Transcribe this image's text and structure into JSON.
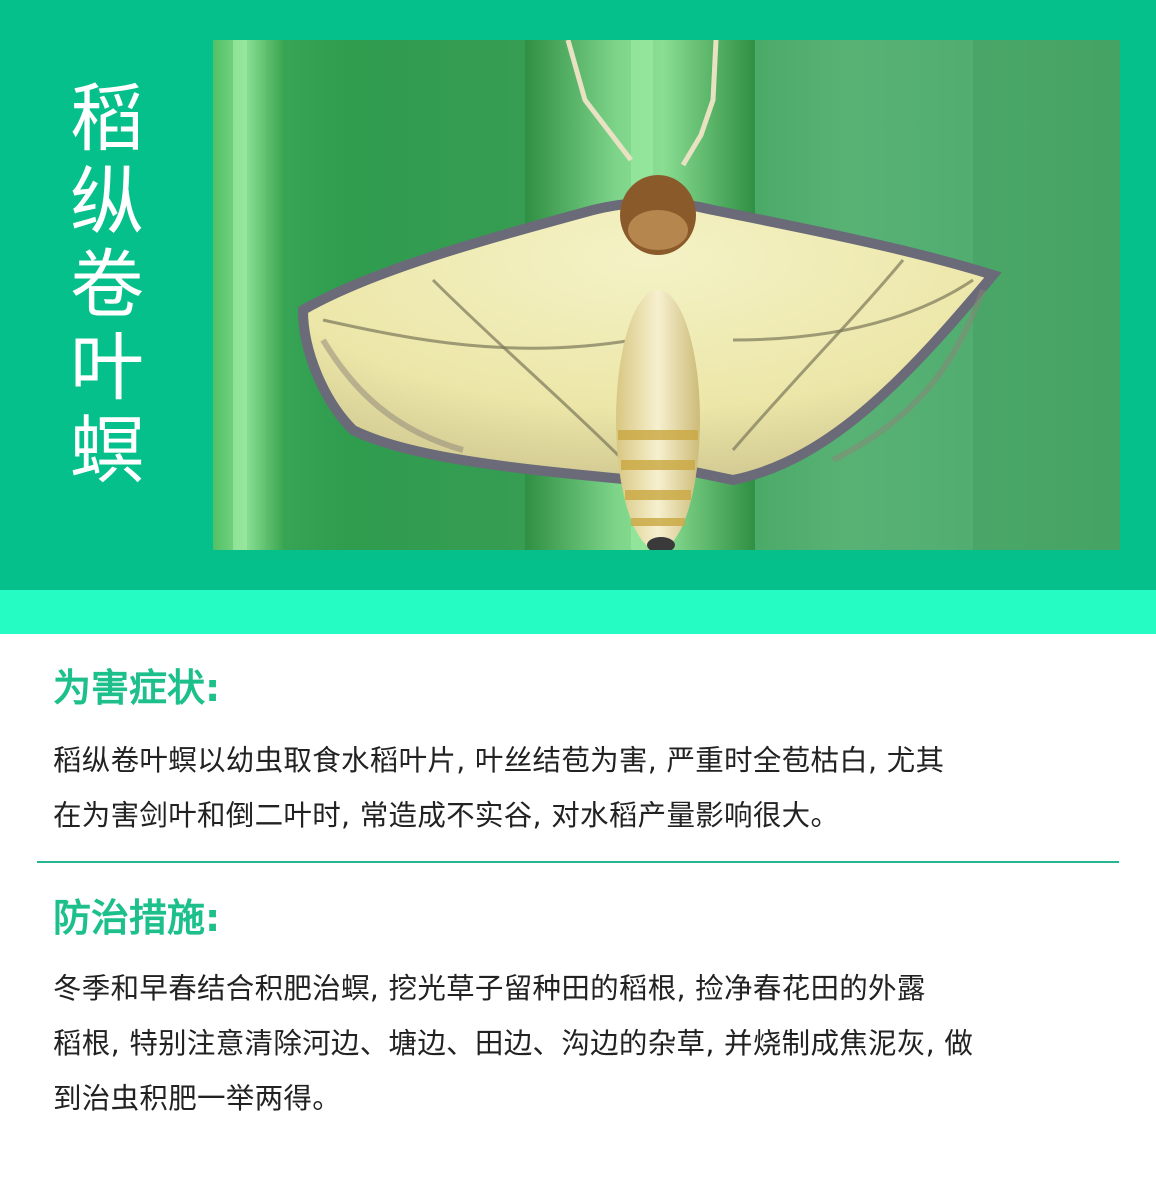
{
  "header": {
    "title_chars": [
      "稻",
      "纵",
      "卷",
      "叶",
      "螟"
    ]
  },
  "photo": {
    "subject": "rice-leaf-roller-moth"
  },
  "symptoms": {
    "heading": "为害症状:",
    "lines": [
      "稻纵卷叶螟以幼虫取食水稻叶片, 叶丝结苞为害, 严重时全苞枯白, 尤其",
      "在为害剑叶和倒二叶时, 常造成不实谷, 对水稻产量影响很大。"
    ]
  },
  "control": {
    "heading": "防治措施:",
    "lines": [
      "冬季和早春结合积肥治螟, 挖光草子留种田的稻根, 捡净春花田的外露",
      "稻根, 特别注意清除河边、塘边、田边、沟边的杂草, 并烧制成焦泥灰, 做",
      "到治虫积肥一举两得。"
    ]
  },
  "colors": {
    "header_bg": "#06c08b",
    "header_strip": "#25fcc4",
    "heading_text": "#1dbf8b",
    "divider": "#27b694"
  }
}
